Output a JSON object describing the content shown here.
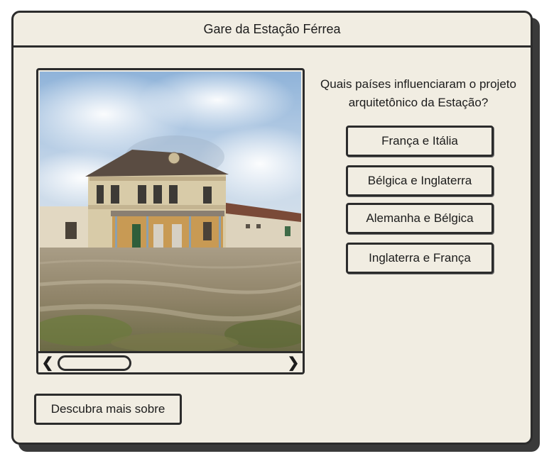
{
  "window": {
    "title": "Gare da Estação Férrea"
  },
  "photo": {
    "subject": "railway-station-building"
  },
  "scrollbar": {
    "left_icon": "chevron-left-icon",
    "right_icon": "chevron-right-icon",
    "left_glyph": "❮",
    "right_glyph": "❯"
  },
  "quiz": {
    "question": "Quais países influenciaram o projeto arquitetônico da Estação?",
    "answers": [
      {
        "label": "França e Itália"
      },
      {
        "label": "Bélgica e Inglaterra"
      },
      {
        "label": "Alemanha e Bélgica"
      },
      {
        "label": "Inglaterra e França"
      }
    ]
  },
  "actions": {
    "more_label": "Descubra mais sobre"
  }
}
